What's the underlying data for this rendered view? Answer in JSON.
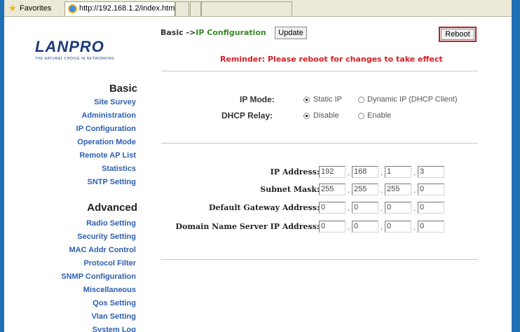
{
  "browser": {
    "favorites_label": "Favorites",
    "tab_url": "http://192.168.1.2/index.htm"
  },
  "brand": {
    "logo_text": "LANPRO",
    "tagline": "THE NATURAL CHOICE IN NETWORKING"
  },
  "sidebar": {
    "basic_heading": "Basic",
    "basic_items": [
      "Site Survey",
      "Administration",
      "IP Configuration",
      "Operation Mode",
      "Remote AP List",
      "Statistics",
      "SNTP Setting"
    ],
    "advanced_heading": "Advanced",
    "advanced_items": [
      "Radio Setting",
      "Security Setting",
      "MAC Addr Control",
      "Protocol Filter",
      "SNMP Configuration",
      "Miscellaneous",
      "Qos Setting",
      "Vlan Setting",
      "System Log"
    ]
  },
  "header": {
    "breadcrumb_prefix": "Basic ->",
    "breadcrumb_current": "IP Configuration",
    "update_label": "Update",
    "reboot_label": "Reboot",
    "reminder": "Reminder: Please reboot for changes to take effect"
  },
  "mode": {
    "ip_mode_label": "IP Mode:",
    "static_label": "Static IP",
    "dynamic_label": "Dynamic IP (DHCP Client)",
    "ip_mode_selected": "Static IP",
    "dhcp_relay_label": "DHCP Relay:",
    "disable_label": "Disable",
    "enable_label": "Enable",
    "dhcp_relay_selected": "Disable"
  },
  "network": {
    "fields": [
      {
        "label": "IP Address:",
        "octets": [
          "192",
          "168",
          "1",
          "3"
        ]
      },
      {
        "label": "Subnet Mask:",
        "octets": [
          "255",
          "255",
          "255",
          "0"
        ]
      },
      {
        "label": "Default Gateway Address:",
        "octets": [
          "0",
          "0",
          "0",
          "0"
        ]
      },
      {
        "label": "Domain Name Server IP Address:",
        "octets": [
          "0",
          "0",
          "0",
          "0"
        ]
      }
    ]
  },
  "colors": {
    "frame_blue": "#1f6fb5",
    "nav_link": "#2d5fb0",
    "breadcrumb_current": "#3a8a2a",
    "reminder_red": "#d52025",
    "reboot_highlight": "#b8202a"
  }
}
